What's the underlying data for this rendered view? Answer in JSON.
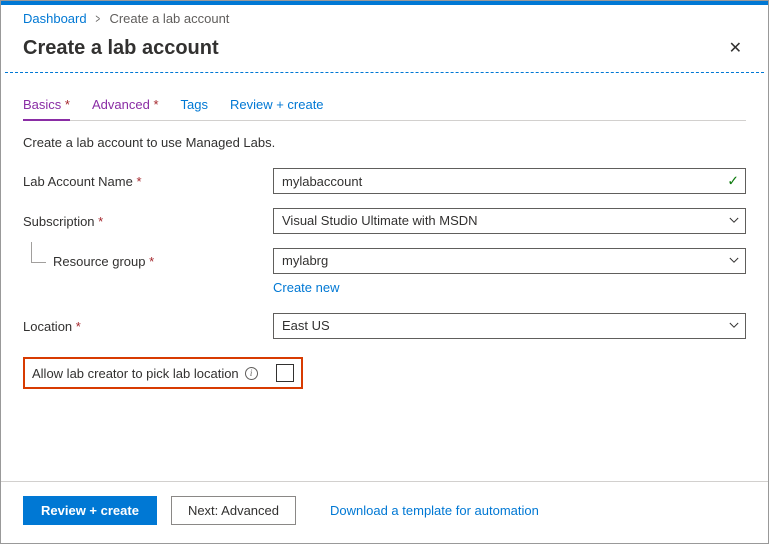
{
  "breadcrumb": {
    "root": "Dashboard",
    "current": "Create a lab account"
  },
  "header": {
    "title": "Create a lab account"
  },
  "tabs": {
    "basics": "Basics",
    "advanced": "Advanced",
    "tags": "Tags",
    "review": "Review + create"
  },
  "intro": "Create a lab account to use Managed Labs.",
  "form": {
    "labAccountName": {
      "label": "Lab Account Name",
      "value": "mylabaccount"
    },
    "subscription": {
      "label": "Subscription",
      "value": "Visual Studio Ultimate with MSDN"
    },
    "resourceGroup": {
      "label": "Resource group",
      "value": "mylabrg",
      "createNew": "Create new"
    },
    "location": {
      "label": "Location",
      "value": "East US"
    },
    "allowPick": {
      "label": "Allow lab creator to pick lab location"
    }
  },
  "footer": {
    "primary": "Review + create",
    "secondary": "Next: Advanced",
    "link": "Download a template for automation"
  }
}
